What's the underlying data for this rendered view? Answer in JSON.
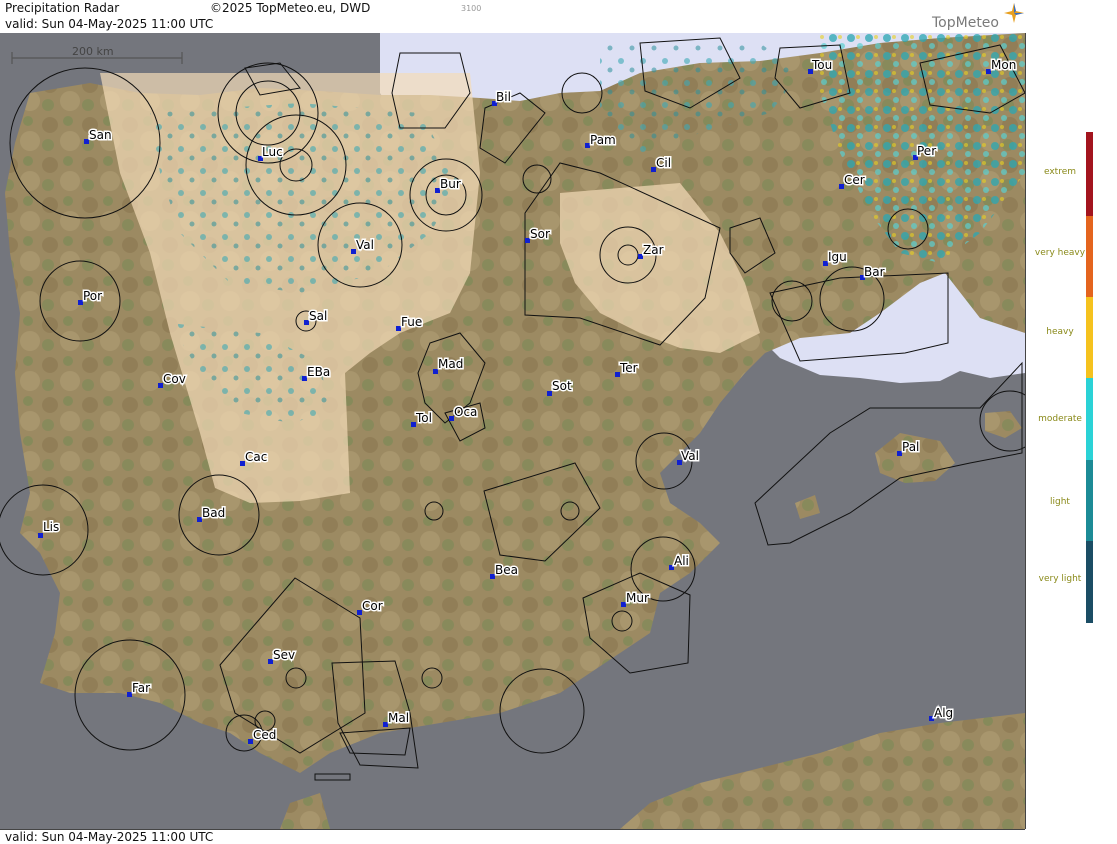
{
  "header": {
    "title": "Precipitation Radar",
    "copyright": "©2025 TopMeteo.eu, DWD",
    "code": "3100",
    "valid": "valid:  Sun  04-May-2025 11:00 UTC",
    "brand": "TopMeteo"
  },
  "footer": {
    "valid": "valid:  Sun  04-May-2025 11:00 UTC"
  },
  "scale": {
    "label": "200 km"
  },
  "legend": {
    "levels": [
      {
        "label": "extrem",
        "color": "#a3141e"
      },
      {
        "label": "very heavy",
        "color": "#e4641e"
      },
      {
        "label": "heavy",
        "color": "#f5c21e"
      },
      {
        "label": "moderate",
        "color": "#2ad2d6"
      },
      {
        "label": "light",
        "color": "#1c8b96"
      },
      {
        "label": "very light",
        "color": "#1b4d64"
      }
    ]
  },
  "colors": {
    "sea": "#74767d",
    "coverage": "#f4dcb8",
    "no_coverage_sea": "#dde0f4",
    "station": "#1020d0"
  },
  "stations": [
    {
      "id": "san",
      "label": "San"
    },
    {
      "id": "luc",
      "label": "Luc"
    },
    {
      "id": "bur",
      "label": "Bur"
    },
    {
      "id": "bil",
      "label": "Bil"
    },
    {
      "id": "pam",
      "label": "Pam"
    },
    {
      "id": "cil",
      "label": "Cil"
    },
    {
      "id": "tou",
      "label": "Tou"
    },
    {
      "id": "mon",
      "label": "Mon"
    },
    {
      "id": "per",
      "label": "Per"
    },
    {
      "id": "cer",
      "label": "Cer"
    },
    {
      "id": "por",
      "label": "Por"
    },
    {
      "id": "val1",
      "label": "Val"
    },
    {
      "id": "sor",
      "label": "Sor"
    },
    {
      "id": "zar",
      "label": "Zar"
    },
    {
      "id": "igu",
      "label": "Igu"
    },
    {
      "id": "bar",
      "label": "Bar"
    },
    {
      "id": "sal",
      "label": "Sal"
    },
    {
      "id": "fue",
      "label": "Fue"
    },
    {
      "id": "mad",
      "label": "Mad"
    },
    {
      "id": "cov",
      "label": "Cov"
    },
    {
      "id": "eba",
      "label": "EBa"
    },
    {
      "id": "ter",
      "label": "Ter"
    },
    {
      "id": "sot",
      "label": "Sot"
    },
    {
      "id": "tol",
      "label": "Tol"
    },
    {
      "id": "oca",
      "label": "Oca"
    },
    {
      "id": "pal",
      "label": "Pal"
    },
    {
      "id": "cac",
      "label": "Cac"
    },
    {
      "id": "val2",
      "label": "Val"
    },
    {
      "id": "lis",
      "label": "Lis"
    },
    {
      "id": "bad",
      "label": "Bad"
    },
    {
      "id": "ali",
      "label": "Ali"
    },
    {
      "id": "bea",
      "label": "Bea"
    },
    {
      "id": "mur",
      "label": "Mur"
    },
    {
      "id": "cor",
      "label": "Cor"
    },
    {
      "id": "sev",
      "label": "Sev"
    },
    {
      "id": "far",
      "label": "Far"
    },
    {
      "id": "mal",
      "label": "Mal"
    },
    {
      "id": "ced",
      "label": "Ced"
    },
    {
      "id": "alg",
      "label": "Alg"
    }
  ]
}
